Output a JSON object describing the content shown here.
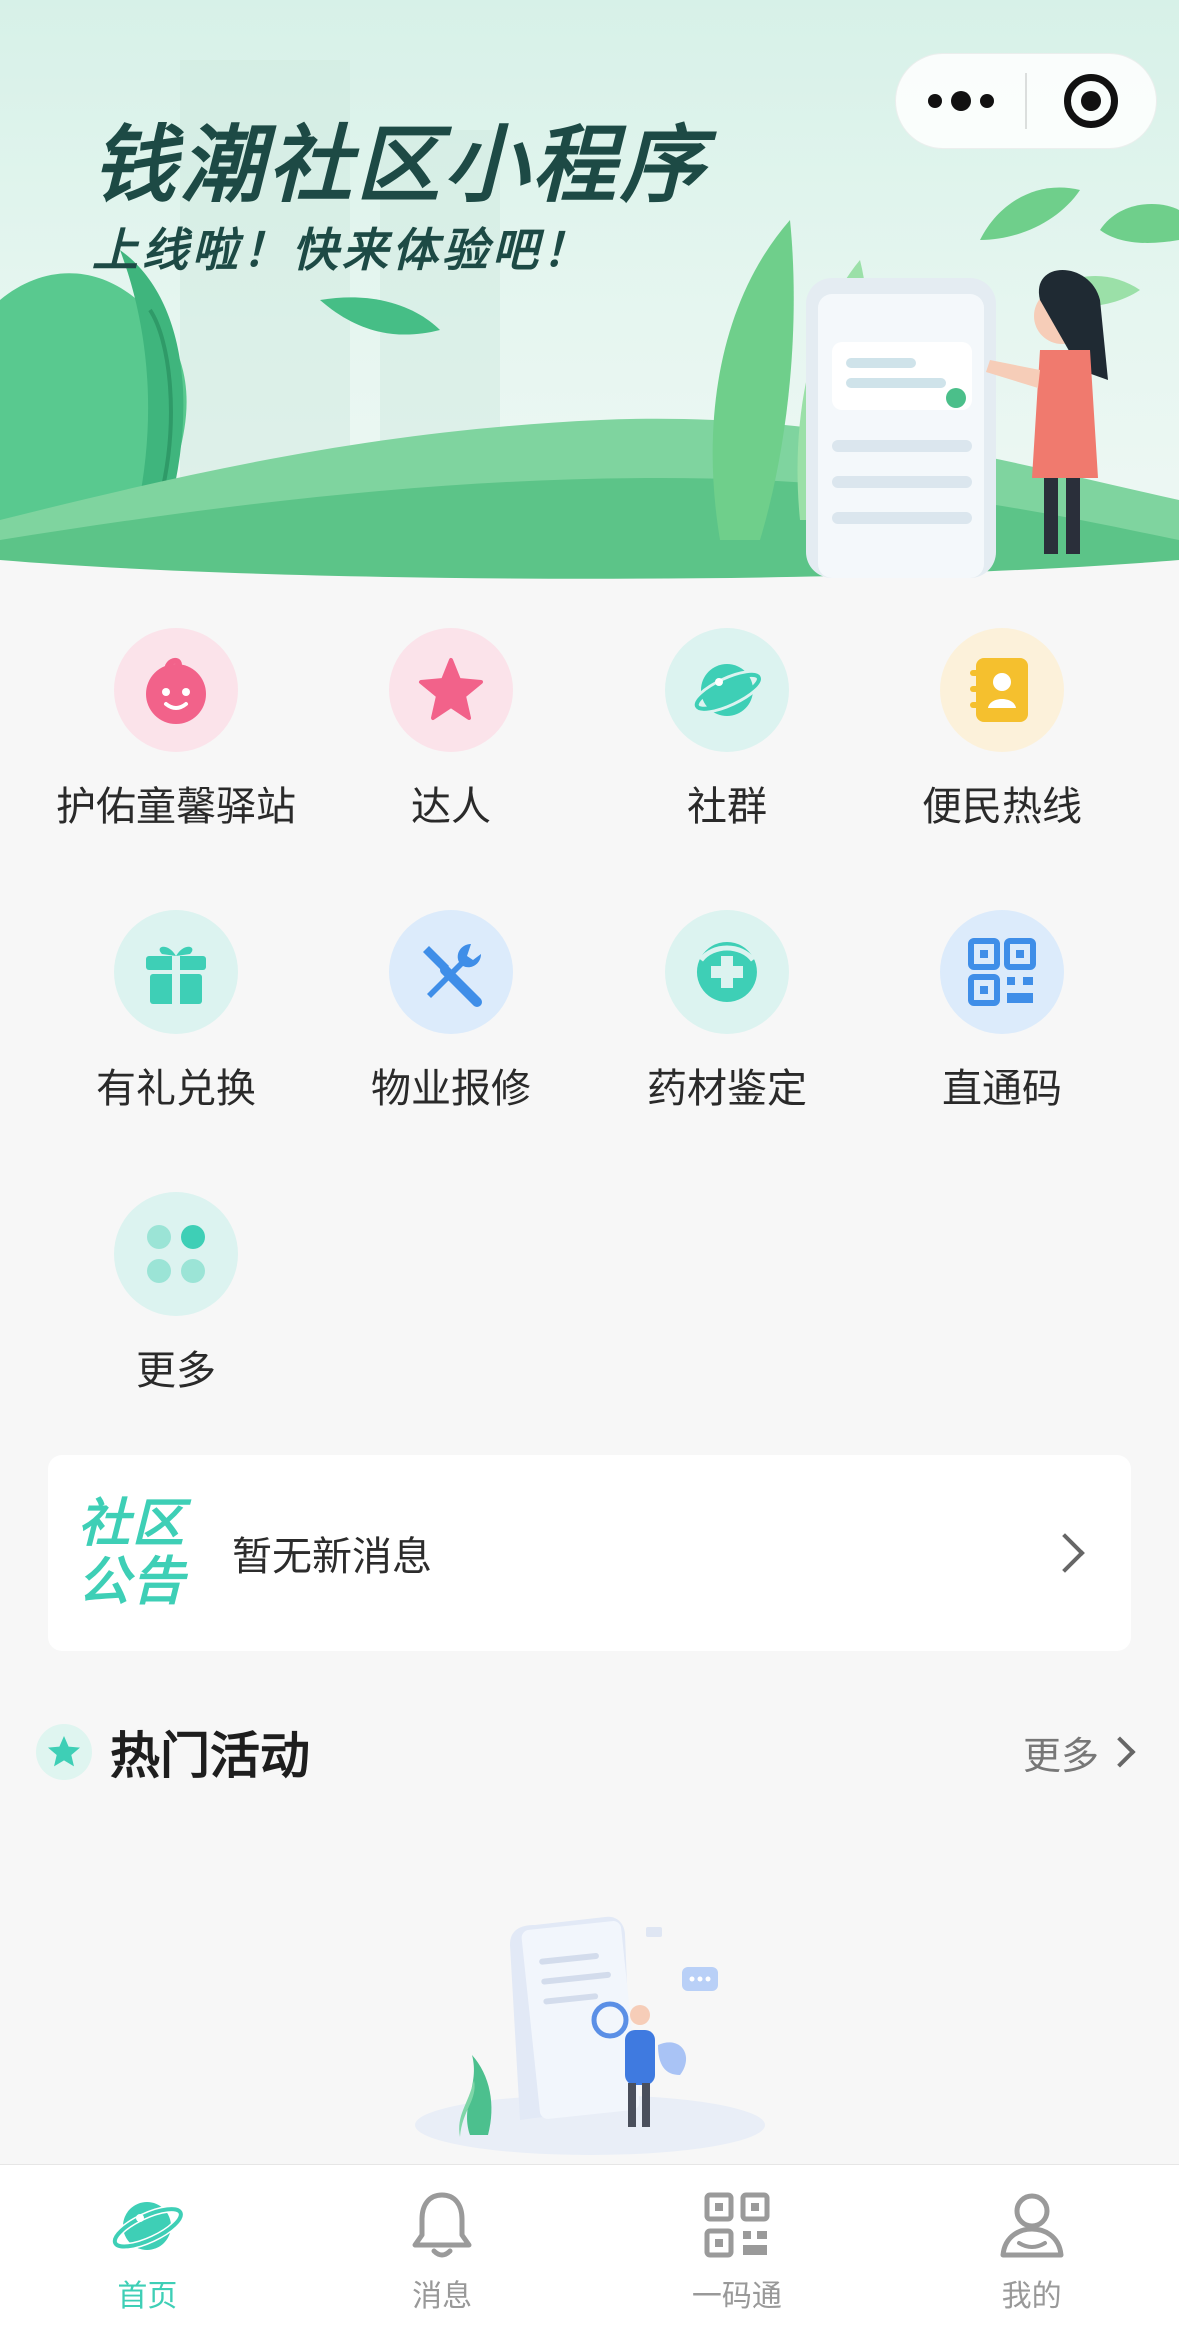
{
  "banner": {
    "title": "钱潮社区小程序",
    "subtitle": "上线啦！快来体验吧！"
  },
  "grid": {
    "items": [
      {
        "label": "护佑童馨驿站",
        "icon": "baby-face-icon",
        "icon_bg": "#fbe3ea",
        "icon_color": "#f2628a"
      },
      {
        "label": "达人",
        "icon": "star-icon",
        "icon_bg": "#fbe3ea",
        "icon_color": "#f2628a"
      },
      {
        "label": "社群",
        "icon": "planet-icon",
        "icon_bg": "#dcf3f0",
        "icon_color": "#3ecfb6"
      },
      {
        "label": "便民热线",
        "icon": "contact-book-icon",
        "icon_bg": "#fcf1da",
        "icon_color": "#f5c02e"
      },
      {
        "label": "有礼兑换",
        "icon": "gift-icon",
        "icon_bg": "#dcf3f0",
        "icon_color": "#3ecfb6"
      },
      {
        "label": "物业报修",
        "icon": "tools-icon",
        "icon_bg": "#dcebfb",
        "icon_color": "#3f8ee8"
      },
      {
        "label": "药材鉴定",
        "icon": "medical-cross-icon",
        "icon_bg": "#dcf3f0",
        "icon_color": "#3ecfb6"
      },
      {
        "label": "直通码",
        "icon": "qr-code-icon",
        "icon_bg": "#dcebfb",
        "icon_color": "#3f8ee8"
      },
      {
        "label": "更多",
        "icon": "more-apps-icon",
        "icon_bg": "#dcf3f0",
        "icon_color": "#3ecfb6"
      }
    ]
  },
  "notice": {
    "badge_line1": "社区",
    "badge_line2": "公告",
    "text": "暂无新消息"
  },
  "hot": {
    "title": "热门活动",
    "more": "更多"
  },
  "tabbar": {
    "items": [
      {
        "label": "首页",
        "icon": "planet-icon",
        "active": true
      },
      {
        "label": "消息",
        "icon": "bell-icon",
        "active": false
      },
      {
        "label": "一码通",
        "icon": "qr-code-icon",
        "active": false
      },
      {
        "label": "我的",
        "icon": "user-icon",
        "active": false
      }
    ]
  },
  "colors": {
    "accent": "#3ecfb6",
    "banner_text": "#1d4a45",
    "background": "#f7f7f7"
  }
}
